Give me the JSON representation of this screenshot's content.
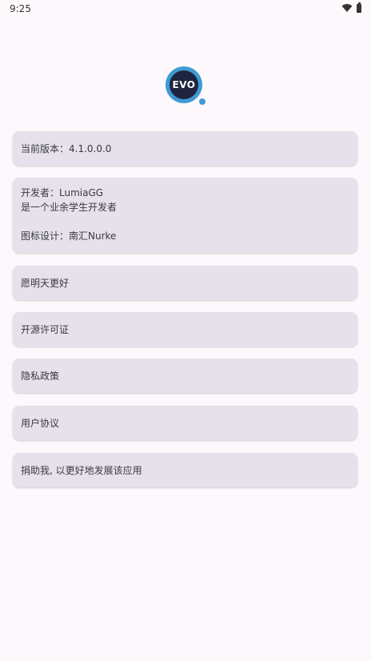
{
  "status_bar": {
    "time": "9:25"
  },
  "logo": {
    "text": "EVO"
  },
  "cards": {
    "version": "当前版本：4.1.0.0.0",
    "developer": "开发者：LumiaGG",
    "developer_note": "是一个业余学生开发者",
    "icon_design": "图标设计：南汇Nurke",
    "wish": "愿明天更好",
    "license": "开源许可证",
    "privacy": "隐私政策",
    "agreement": "用户协议",
    "donate": "捐助我, 以更好地发展该应用"
  }
}
